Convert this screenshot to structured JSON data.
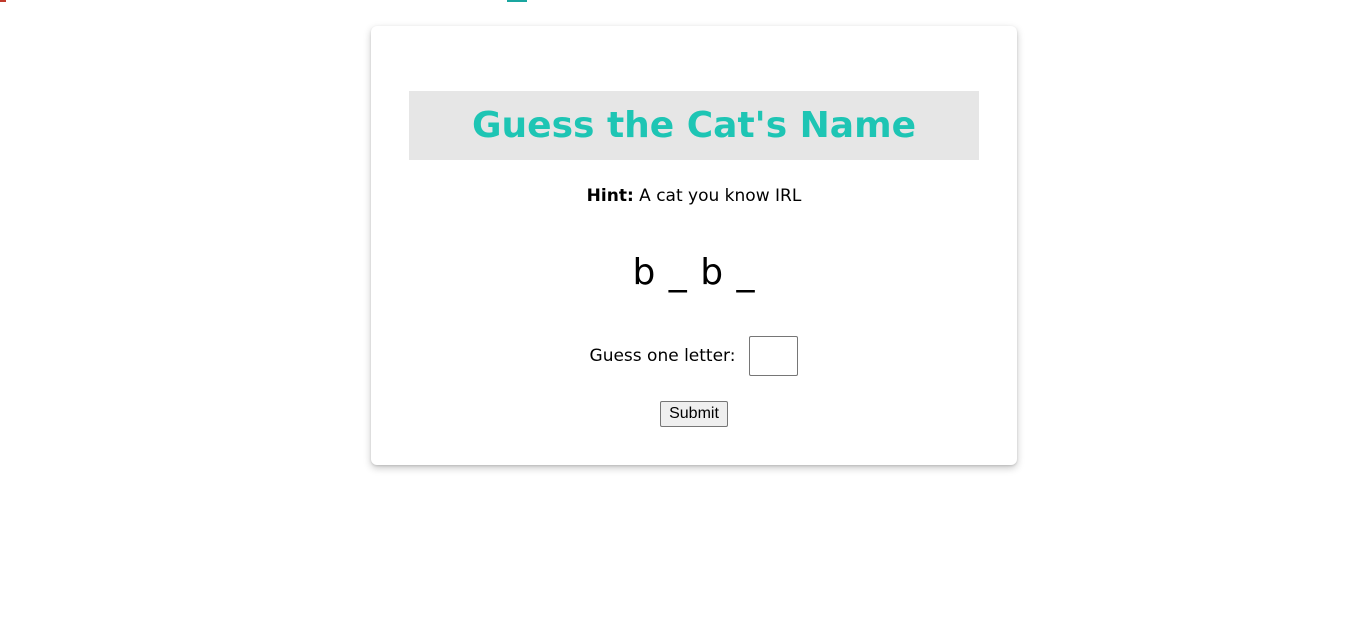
{
  "game": {
    "title": "Guess the Cat's Name",
    "hint_label": "Hint:",
    "hint_text": " A cat you know IRL",
    "word_display": "b _ b _",
    "guess_label": "Guess one letter:",
    "guess_value": "",
    "submit_label": "Submit"
  },
  "colors": {
    "title": "#1ec5b4",
    "title_band": "#e6e6e6",
    "card_background": "#ffffff"
  }
}
